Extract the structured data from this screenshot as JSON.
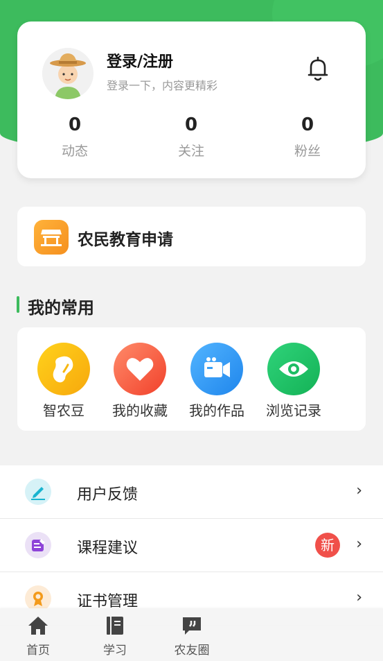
{
  "profile": {
    "title": "登录/注册",
    "subtitle": "登录一下，内容更精彩",
    "stats": [
      {
        "value": "0",
        "label": "动态"
      },
      {
        "value": "0",
        "label": "关注"
      },
      {
        "value": "0",
        "label": "粉丝"
      }
    ]
  },
  "education": {
    "label": "农民教育申请"
  },
  "favorites": {
    "title": "我的常用",
    "items": [
      {
        "label": "智农豆",
        "icon": "bean-icon"
      },
      {
        "label": "我的收藏",
        "icon": "heart-icon"
      },
      {
        "label": "我的作品",
        "icon": "video-camera-icon"
      },
      {
        "label": "浏览记录",
        "icon": "eye-icon"
      }
    ]
  },
  "menu": [
    {
      "label": "用户反馈",
      "icon": "pen-icon",
      "chevron": "›"
    },
    {
      "label": "课程建议",
      "icon": "edit-note-icon",
      "badge": "新",
      "chevron": "›"
    },
    {
      "label": "证书管理",
      "icon": "medal-icon",
      "chevron": "›"
    }
  ],
  "nav": [
    {
      "label": "首页",
      "icon": "home-icon"
    },
    {
      "label": "学习",
      "icon": "book-icon"
    },
    {
      "label": "农友圈",
      "icon": "chat-quote-icon"
    }
  ],
  "colors": {
    "brand": "#3dbb5d",
    "badge": "#f0504a"
  }
}
